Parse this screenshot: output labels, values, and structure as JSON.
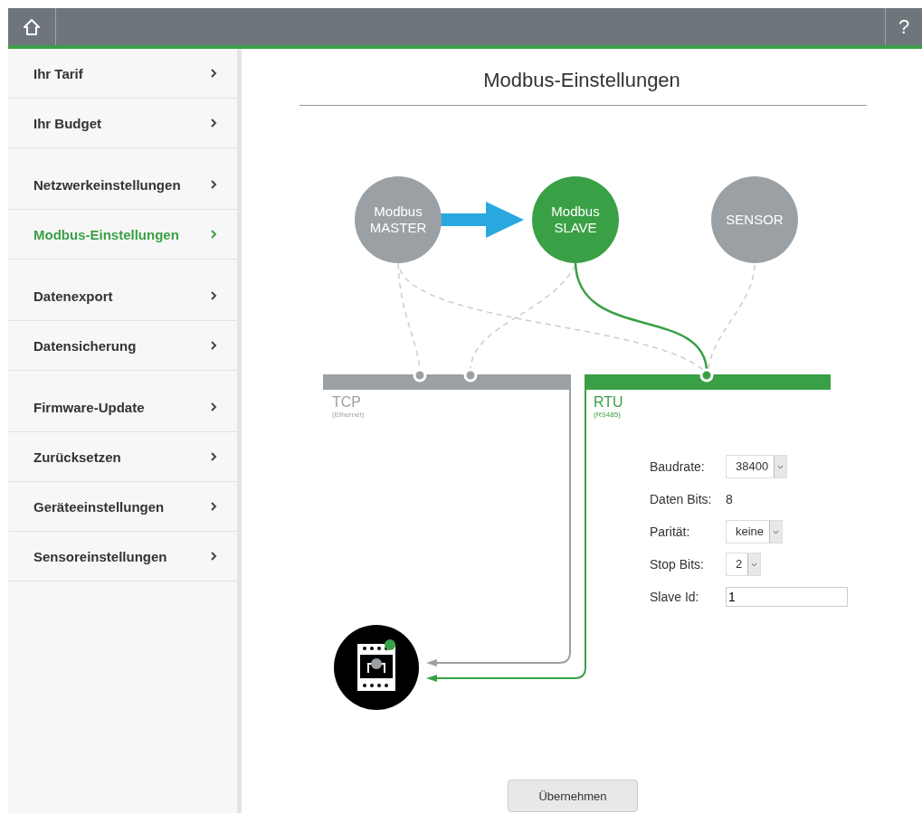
{
  "topbar": {
    "help": "?"
  },
  "sidebar": {
    "groups": [
      {
        "items": [
          {
            "label": "Ihr Tarif",
            "selected": false
          },
          {
            "label": "Ihr Budget",
            "selected": false
          }
        ]
      },
      {
        "items": [
          {
            "label": "Netzwerkeinstellungen",
            "selected": false
          },
          {
            "label": "Modbus-Einstellungen",
            "selected": true
          }
        ]
      },
      {
        "items": [
          {
            "label": "Datenexport",
            "selected": false
          },
          {
            "label": "Datensicherung",
            "selected": false
          }
        ]
      },
      {
        "items": [
          {
            "label": "Firmware-Update",
            "selected": false
          },
          {
            "label": "Zurücksetzen",
            "selected": false
          },
          {
            "label": "Geräteeinstellungen",
            "selected": false
          },
          {
            "label": "Sensoreinstellungen",
            "selected": false
          }
        ]
      }
    ]
  },
  "title": "Modbus-Einstellungen",
  "nodes": [
    {
      "lines": [
        "Modbus",
        "MASTER"
      ],
      "selected": false
    },
    {
      "lines": [
        "Modbus",
        "SLAVE"
      ],
      "selected": true
    },
    {
      "lines": [
        "SENSOR"
      ],
      "selected": false
    }
  ],
  "buses": [
    {
      "name": "TCP",
      "subtitle": "(Ethernet)",
      "selected": false
    },
    {
      "name": "RTU",
      "subtitle": "(RS485)",
      "selected": true
    }
  ],
  "fields": [
    {
      "label": "Baudrate:",
      "kind": "select",
      "value": "38400"
    },
    {
      "label": "Daten Bits:",
      "kind": "text",
      "value": "8"
    },
    {
      "label": "Parität:",
      "kind": "select",
      "value": "keine"
    },
    {
      "label": "Stop Bits:",
      "kind": "select",
      "value": "2"
    },
    {
      "label": "Slave Id:",
      "kind": "input",
      "value": "1"
    }
  ],
  "apply_button": "Übernehmen"
}
